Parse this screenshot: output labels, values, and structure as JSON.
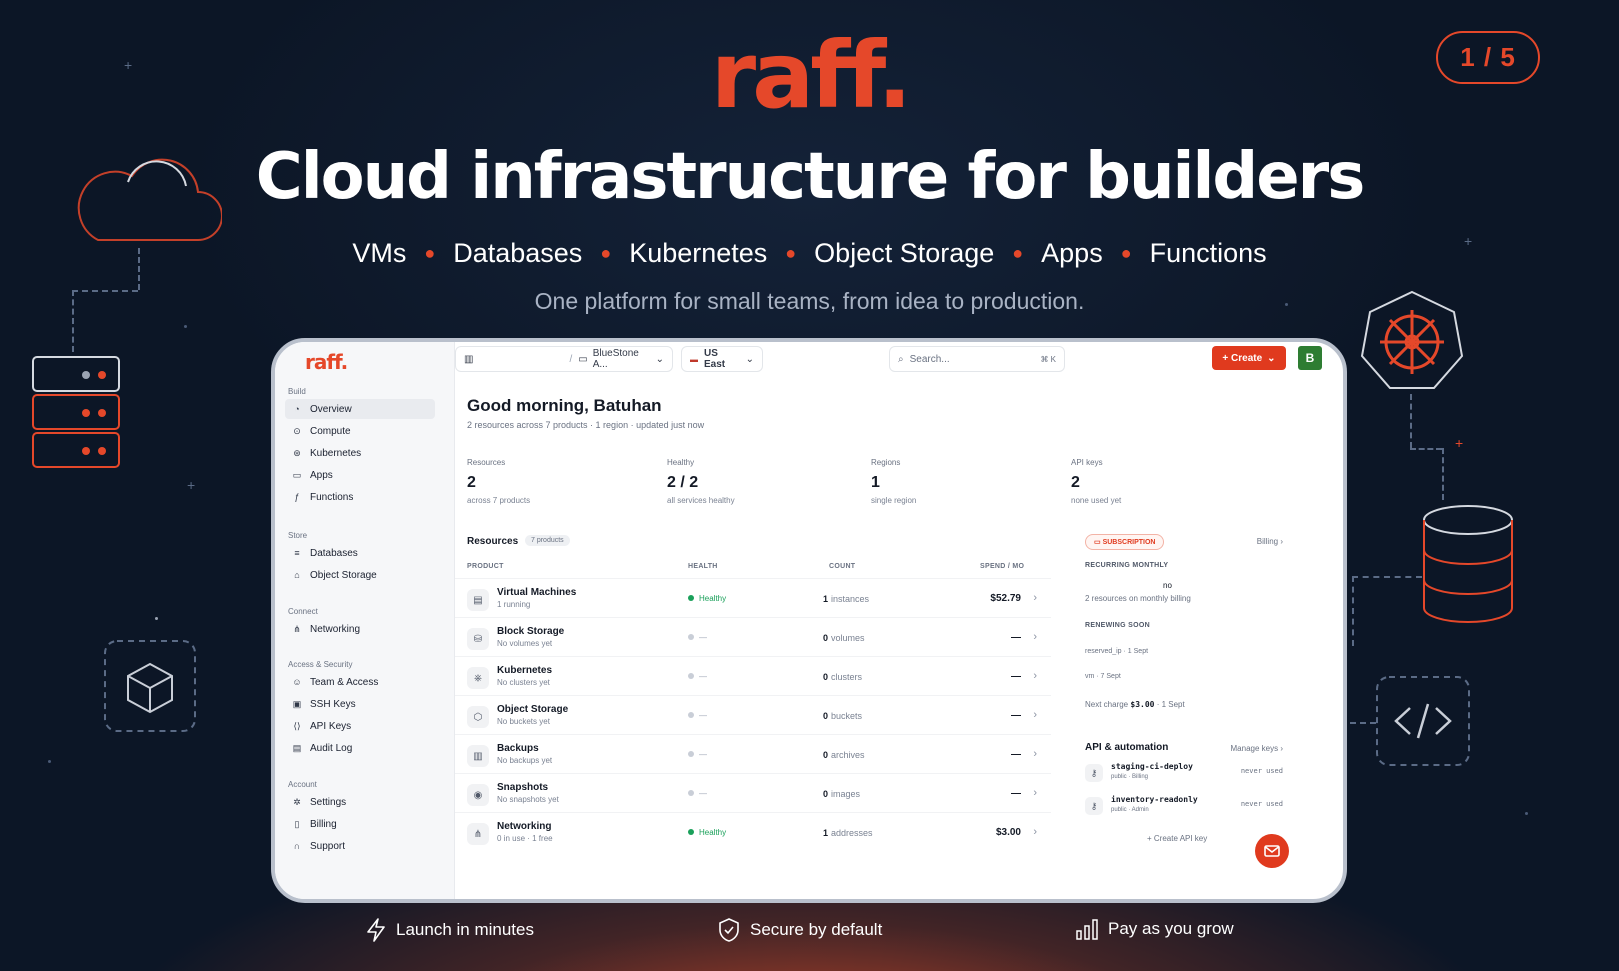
{
  "hero": {
    "brand": "raff.",
    "counter": "1 / 5",
    "headline": "Cloud infrastructure for builders",
    "products": [
      "VMs",
      "Databases",
      "Kubernetes",
      "Object Storage",
      "Apps",
      "Functions"
    ],
    "tagline": "One platform for small teams, from idea to production."
  },
  "app": {
    "logo": "raff.",
    "topbar": {
      "project": "BlueStone A...",
      "region": "US East",
      "search_placeholder": "Search...",
      "search_shortcut": "⌘ K",
      "create_label": "+ Create",
      "avatar_initial": "B"
    },
    "sidebar": {
      "sections": [
        {
          "title": "Build",
          "items": [
            "Overview",
            "Compute",
            "Kubernetes",
            "Apps",
            "Functions"
          ]
        },
        {
          "title": "Store",
          "items": [
            "Databases",
            "Object Storage"
          ]
        },
        {
          "title": "Connect",
          "items": [
            "Networking"
          ]
        },
        {
          "title": "Access & Security",
          "items": [
            "Team & Access",
            "SSH Keys",
            "API Keys",
            "Audit Log"
          ]
        },
        {
          "title": "Account",
          "items": [
            "Settings",
            "Billing",
            "Support"
          ]
        }
      ]
    },
    "greeting": "Good morning, Batuhan",
    "greeting_sub": "2 resources across 7 products · 1 region · updated just now",
    "stats": [
      {
        "label": "Resources",
        "value": "2",
        "sub": "across 7 products"
      },
      {
        "label": "Healthy",
        "value": "2 / 2",
        "sub": "all services healthy"
      },
      {
        "label": "Regions",
        "value": "1",
        "sub": "single region"
      },
      {
        "label": "API keys",
        "value": "2",
        "sub": "none used yet"
      }
    ],
    "resources": {
      "title": "Resources",
      "badge": "7 products",
      "columns": [
        "PRODUCT",
        "HEALTH",
        "COUNT",
        "SPEND / MO"
      ],
      "rows": [
        {
          "name": "Virtual Machines",
          "sub": "1 running",
          "health": "Healthy",
          "count": "1",
          "unit": "instances",
          "spend": "$52.79",
          "icon": "server-icon"
        },
        {
          "name": "Block Storage",
          "sub": "No volumes yet",
          "health": "—",
          "count": "0",
          "unit": "volumes",
          "spend": "—",
          "icon": "disk-icon"
        },
        {
          "name": "Kubernetes",
          "sub": "No clusters yet",
          "health": "—",
          "count": "0",
          "unit": "clusters",
          "spend": "—",
          "icon": "ship-icon"
        },
        {
          "name": "Object Storage",
          "sub": "No buckets yet",
          "health": "—",
          "count": "0",
          "unit": "buckets",
          "spend": "—",
          "icon": "cube-icon"
        },
        {
          "name": "Backups",
          "sub": "No backups yet",
          "health": "—",
          "count": "0",
          "unit": "archives",
          "spend": "—",
          "icon": "archive-icon"
        },
        {
          "name": "Snapshots",
          "sub": "No snapshots yet",
          "health": "—",
          "count": "0",
          "unit": "images",
          "spend": "—",
          "icon": "camera-icon"
        },
        {
          "name": "Networking",
          "sub": "0 in use · 1 free",
          "health": "Healthy",
          "count": "1",
          "unit": "addresses",
          "spend": "$3.00",
          "icon": "network-icon"
        }
      ]
    },
    "subscription": {
      "badge": "SUBSCRIPTION",
      "billing_link": "Billing",
      "recurring_label": "RECURRING MONTHLY",
      "recurring_value": "no",
      "recurring_sub": "2 resources on monthly billing",
      "renewing_label": "RENEWING SOON",
      "renewing": [
        "reserved_ip · 1 Sept",
        "vm · 7 Sept"
      ],
      "next_charge_prefix": "Next charge",
      "next_charge_amount": "$3.00",
      "next_charge_date": "· 1 Sept"
    },
    "api": {
      "title": "API & automation",
      "manage_link": "Manage keys",
      "keys": [
        {
          "name": "staging-ci-deploy",
          "meta": "public · Billing",
          "status": "never used"
        },
        {
          "name": "inventory-readonly",
          "meta": "public · Admin",
          "status": "never used"
        }
      ],
      "create_label": "+ Create API key"
    }
  },
  "features": [
    {
      "label": "Launch in minutes",
      "icon": "lightning-icon"
    },
    {
      "label": "Secure by default",
      "icon": "shield-check-icon"
    },
    {
      "label": "Pay as you grow",
      "icon": "bar-chart-icon"
    }
  ],
  "colors": {
    "accent": "#e5482a",
    "background": "#0c1626",
    "healthy": "#1aa05a"
  }
}
